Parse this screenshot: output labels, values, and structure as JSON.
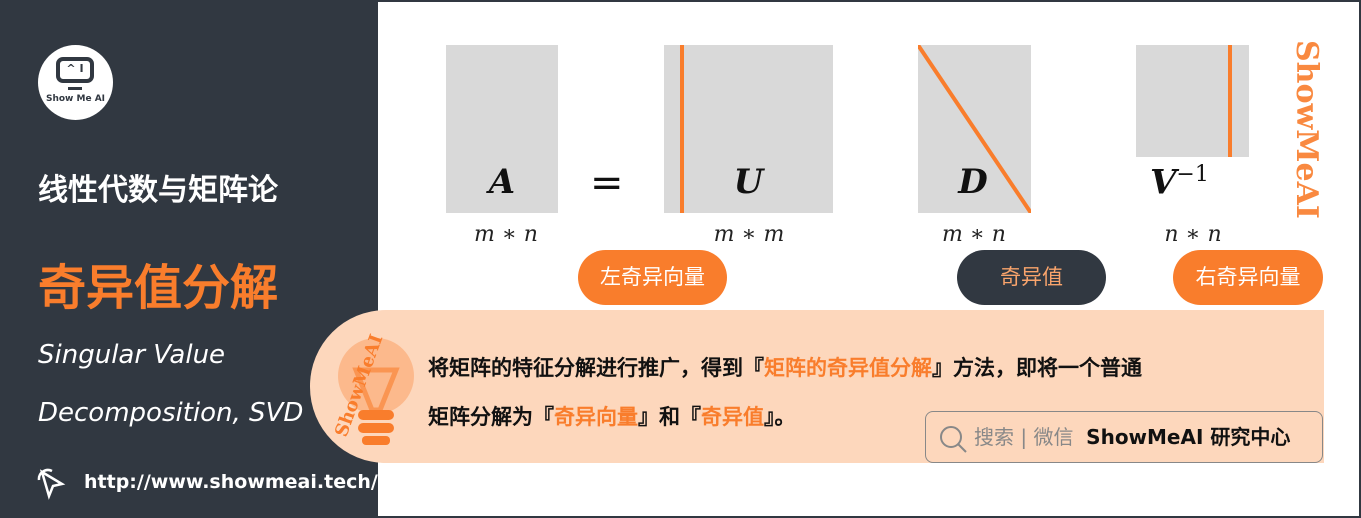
{
  "brand": {
    "logo_text": "Show Me AI",
    "logo_face": "^ I",
    "watermark": "ShowMeAI"
  },
  "left": {
    "subtitle": "线性代数与矩阵论",
    "title": "奇异值分解",
    "en_line1": "Singular Value",
    "en_line2": "Decomposition, SVD",
    "url": "http://www.showmeai.tech/"
  },
  "diagram": {
    "matrices": [
      {
        "symbol": "A",
        "dim": "m ∗ n"
      },
      {
        "symbol": "U",
        "dim": "m ∗ m"
      },
      {
        "symbol": "D",
        "dim": "m ∗ n"
      },
      {
        "symbol": "V",
        "sup": "−1",
        "dim": "n ∗ n"
      }
    ],
    "equals": "=",
    "labels": [
      "左奇异向量",
      "奇异值",
      "右奇异向量"
    ]
  },
  "note": {
    "line1_a": "将矩阵的特征分解进行推广，得到『",
    "line1_hl": "矩阵的奇异值分解",
    "line1_b": "』方法，即将一个普通",
    "line2_a": "矩阵分解为『",
    "line2_hl1": "奇异向量",
    "line2_b": "』和『",
    "line2_hl2": "奇异值",
    "line2_c": "』。"
  },
  "search": {
    "label": "搜索 | 微信",
    "brand": "ShowMeAI 研究中心"
  },
  "colors": {
    "accent": "#f97d2c",
    "dark": "#313841",
    "peach": "#fdd7bc",
    "matrix": "#d9d9d9"
  }
}
